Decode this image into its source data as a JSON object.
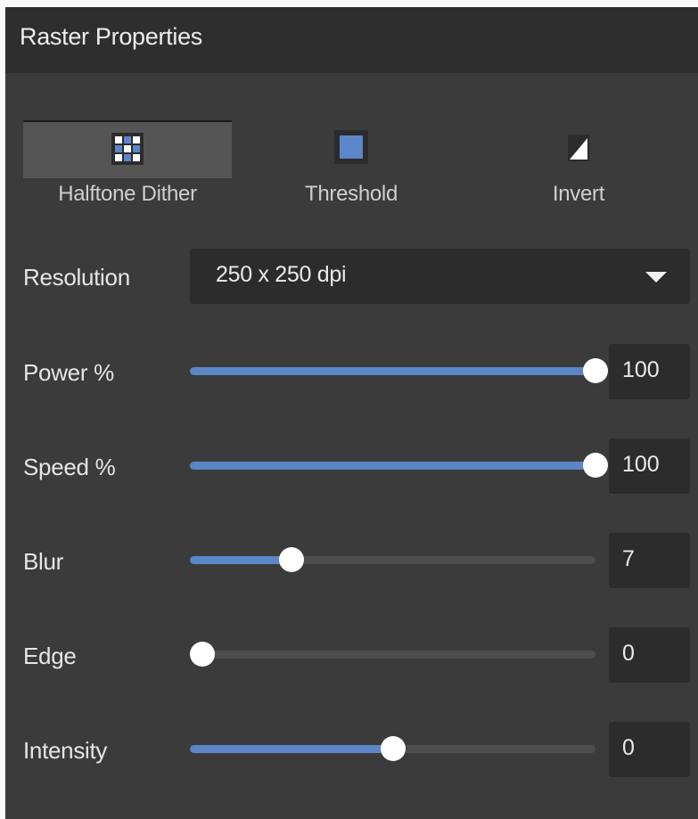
{
  "panel": {
    "title": "Raster Properties"
  },
  "modes": [
    {
      "label": "Halftone Dither",
      "icon": "halftone-grid-icon",
      "active": true
    },
    {
      "label": "Threshold",
      "icon": "threshold-square-icon",
      "active": false
    },
    {
      "label": "Invert",
      "icon": "invert-triangle-icon",
      "active": false
    }
  ],
  "resolution": {
    "label": "Resolution",
    "value": "250 x 250 dpi"
  },
  "sliders": [
    {
      "label": "Power %",
      "value": "100",
      "level": 1.0
    },
    {
      "label": "Speed %",
      "value": "100",
      "level": 1.0
    },
    {
      "label": "Blur",
      "value": "7",
      "level": 0.25
    },
    {
      "label": "Edge",
      "value": "0",
      "level": 0.0
    },
    {
      "label": "Intensity",
      "value": "0",
      "level": 0.5
    }
  ],
  "colors": {
    "accent": "#5b86c7",
    "panel": "#3b3b3b",
    "header": "#2e2e2e",
    "field": "#2c2c2c"
  }
}
